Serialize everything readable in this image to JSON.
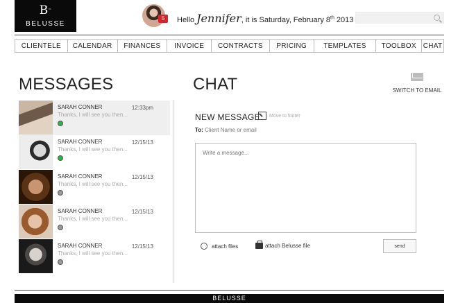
{
  "brand": {
    "mark": "B",
    "tm": "™",
    "name": "BELUSSE"
  },
  "header": {
    "hello": "Hello",
    "user_name": "Jennifer",
    "it_is": ", it is",
    "date_prefix": "Saturday, February 8",
    "date_suffix": "th",
    "year": "2013",
    "notification_count": "5",
    "search_placeholder": ""
  },
  "nav": [
    "CLIENTELE",
    "CALENDAR",
    "FINANCES",
    "INVOICE",
    "CONTRACTS",
    "PRICING",
    "TEMPLATES",
    "TOOLBOX",
    "CHAT"
  ],
  "messages": {
    "title": "MESSAGES",
    "items": [
      {
        "name": "SARAH CONNER",
        "time": "12:33pm",
        "preview": "Thanks, I will see you then...",
        "status": "online",
        "selected": true
      },
      {
        "name": "SARAH CONNER",
        "time": "12/15/13",
        "preview": "Thanks, I will see you then...",
        "status": "online",
        "selected": false
      },
      {
        "name": "SARAH CONNER",
        "time": "12/15/13",
        "preview": "Thanks, I will see you then...",
        "status": "offline",
        "selected": false
      },
      {
        "name": "SARAH CONNER",
        "time": "12/15/13",
        "preview": "Thanks, I will see you then...",
        "status": "offline",
        "selected": false
      },
      {
        "name": "SARAH CONNER",
        "time": "12/15/13",
        "preview": "Thanks, I will see you then...",
        "status": "offline",
        "selected": false
      }
    ]
  },
  "chat": {
    "title": "CHAT",
    "switch_label": "SWITCH TO EMAIL",
    "new_message": "NEW MESSAGE",
    "move_label": "Move to footer",
    "to_label": "To:",
    "to_placeholder": "Client Name or email",
    "message_placeholder": "Write a message...",
    "attach_files": "attach files",
    "attach_belusse": "attach Belusse file",
    "send": "send"
  },
  "footer": {
    "brand": "BELUSSE"
  },
  "colors": {
    "online": "#2fb24a",
    "offline": "#999999",
    "badge": "#d4252b"
  }
}
